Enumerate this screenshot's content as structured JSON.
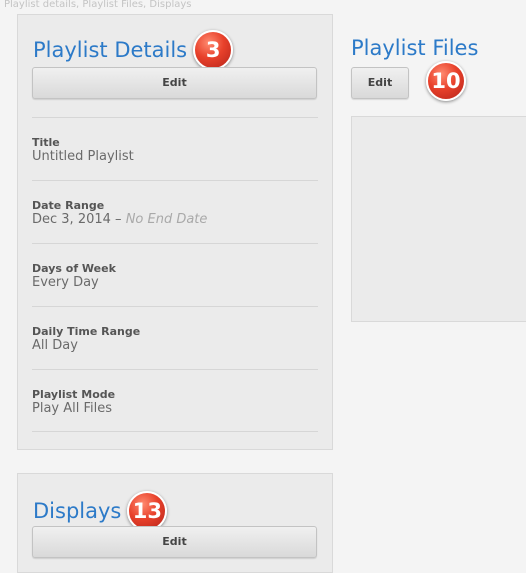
{
  "top_strip_text": "Playlist details, Playlist Files, Displays",
  "playlist_details": {
    "heading": "Playlist Details",
    "badge": "3",
    "edit_label": "Edit",
    "fields": [
      {
        "label": "Title",
        "value": "Untitled Playlist"
      },
      {
        "label": "Date Range",
        "value": "Dec 3, 2014 – ",
        "value_muted": "No End Date"
      },
      {
        "label": "Days of Week",
        "value": "Every Day"
      },
      {
        "label": "Daily Time Range",
        "value": "All Day"
      },
      {
        "label": "Playlist Mode",
        "value": "Play All Files"
      }
    ]
  },
  "playlist_files": {
    "heading": "Playlist Files",
    "badge": "10",
    "edit_label": "Edit"
  },
  "displays": {
    "heading": "Displays",
    "badge": "13",
    "edit_label": "Edit"
  },
  "colors": {
    "heading_blue": "#2c7ac8",
    "badge_red": "#e8412b",
    "panel_bg": "#ebebeb",
    "page_bg": "#f4f4f4"
  }
}
